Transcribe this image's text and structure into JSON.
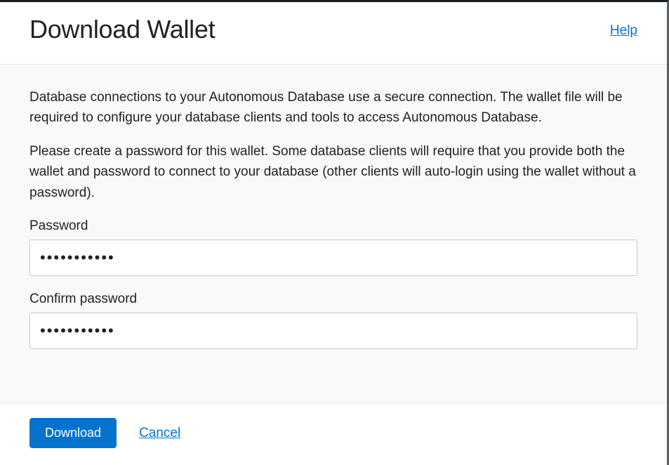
{
  "header": {
    "title": "Download Wallet",
    "help_label": "Help"
  },
  "body": {
    "paragraph1": "Database connections to your Autonomous Database use a secure connection. The wallet file will be required to configure your database clients and tools to access Autonomous Database.",
    "paragraph2": "Please create a password for this wallet. Some database clients will require that you provide both the wallet and password to connect to your database (other clients will auto-login using the wallet without a password).",
    "password_label": "Password",
    "password_value": "•••••••••••",
    "confirm_label": "Confirm password",
    "confirm_value": "•••••••••••"
  },
  "footer": {
    "download_label": "Download",
    "cancel_label": "Cancel"
  }
}
